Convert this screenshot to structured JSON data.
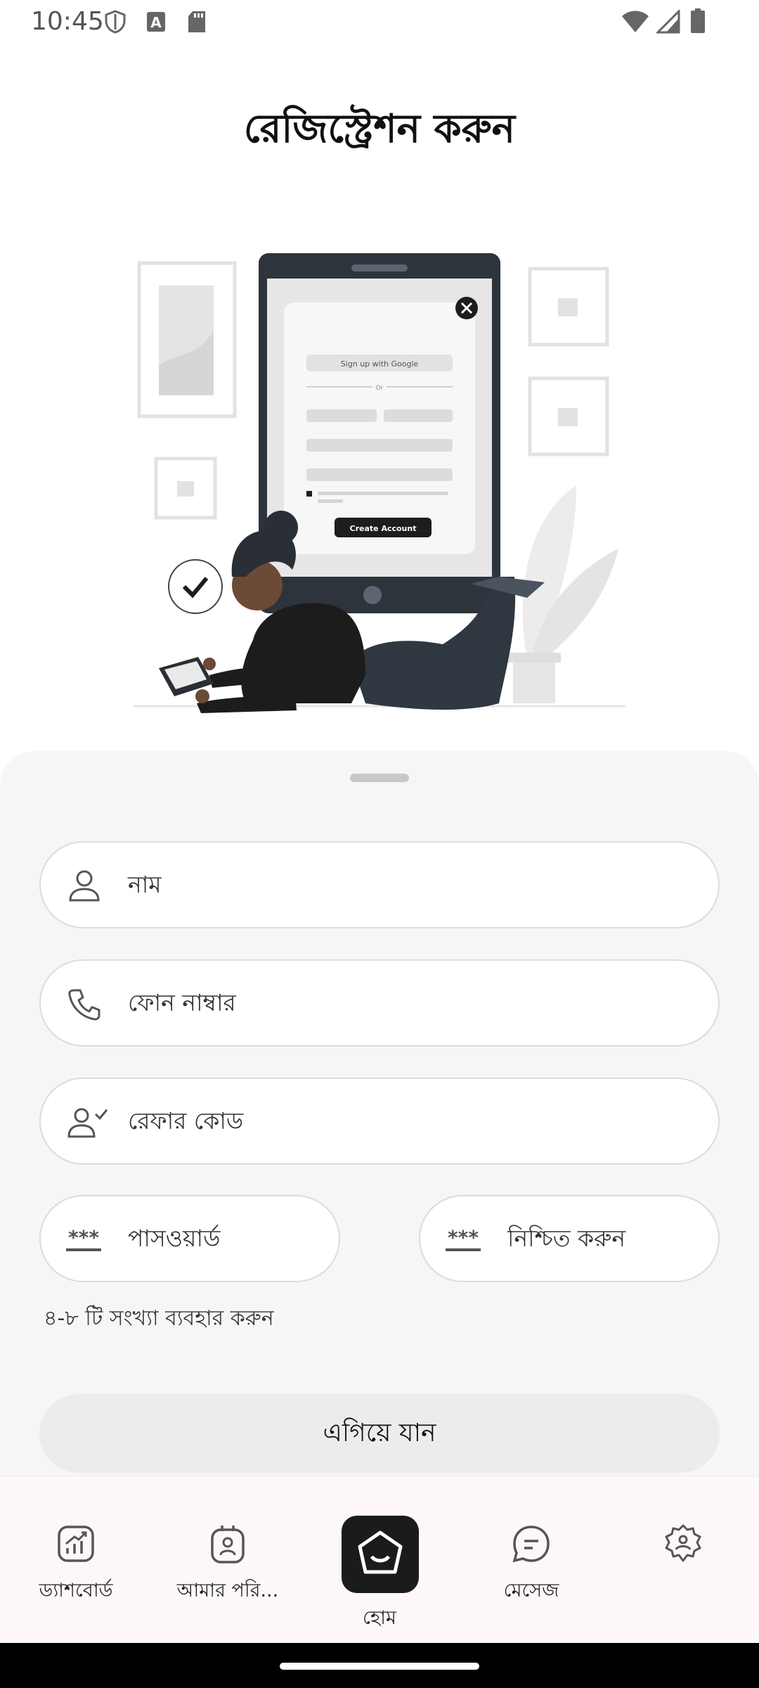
{
  "status_bar": {
    "time": "10:45"
  },
  "page": {
    "title": "রেজিস্ট্রেশন করুন"
  },
  "illustration": {
    "google_button_label": "Sign up with Google",
    "or_label": "Or",
    "create_account_label": "Create Account"
  },
  "form": {
    "name_placeholder": "নাম",
    "phone_placeholder": "ফোন নাম্বার",
    "refer_placeholder": "রেফার কোড",
    "password_placeholder": "পাসওয়ার্ড",
    "confirm_placeholder": "নিশ্চিত করুন",
    "password_hint": "৪-৮ টি সংখ্যা ব্যবহার করুন",
    "submit_label": "এগিয়ে যান"
  },
  "bottom_nav": {
    "items": [
      {
        "label": "ড্যাশবোর্ড",
        "icon": "dashboard-chart-icon"
      },
      {
        "label": "আমার পরি...",
        "icon": "id-badge-icon"
      },
      {
        "label": "হোম",
        "icon": "home-icon"
      },
      {
        "label": "মেসেজ",
        "icon": "message-icon"
      },
      {
        "label": "",
        "icon": "settings-gear-icon"
      }
    ]
  },
  "colors": {
    "sheet_background": "#f6f6f6",
    "home_button": "#1b1b1b",
    "nav_background": "#fdf7fa"
  }
}
